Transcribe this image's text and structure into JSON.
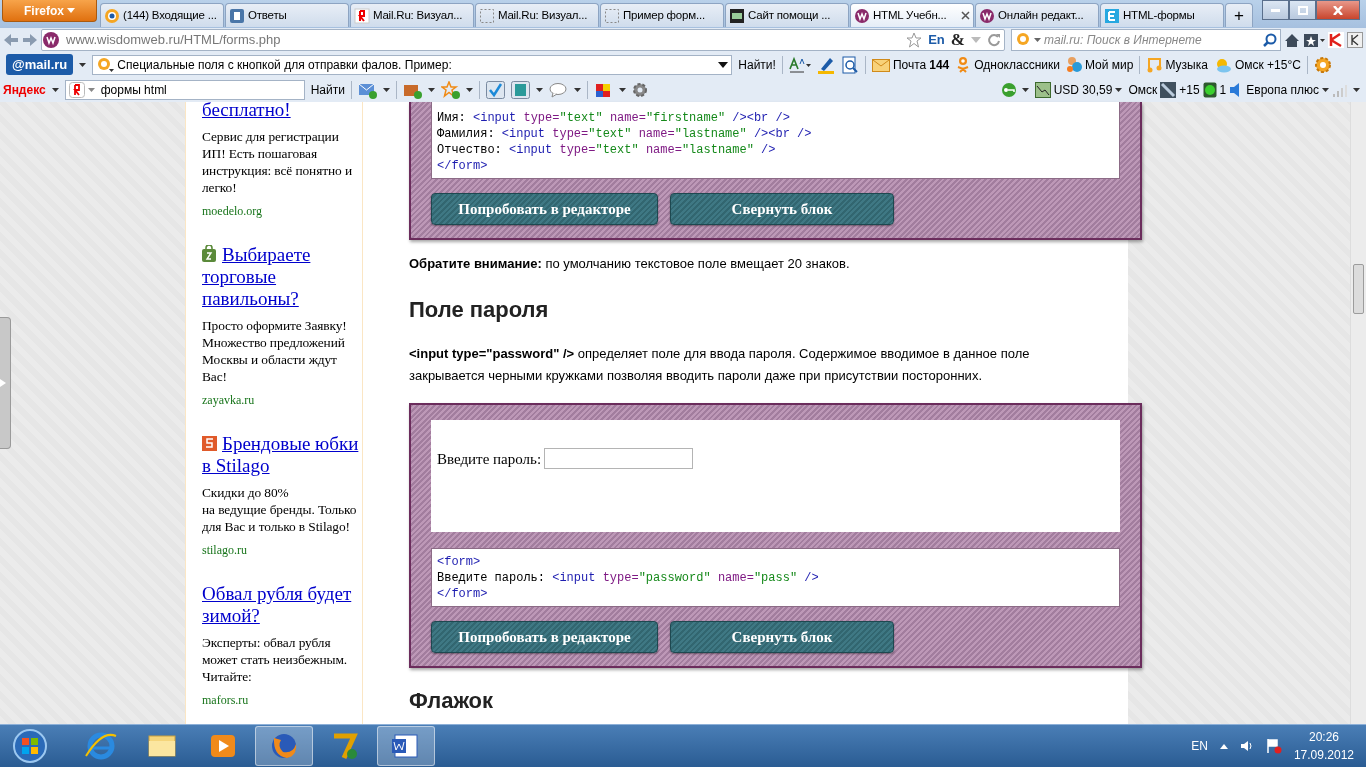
{
  "browser": {
    "menu_button": "Firefox",
    "tabs": [
      {
        "label": "(144) Входящие ...",
        "selected": false
      },
      {
        "label": "Ответы",
        "selected": false
      },
      {
        "label": "Mail.Ru: Визуал...",
        "selected": false
      },
      {
        "label": "Mail.Ru: Визуал...",
        "selected": false
      },
      {
        "label": "Пример форм...",
        "selected": false
      },
      {
        "label": "Сайт помощи ...",
        "selected": false
      },
      {
        "label": "HTML Учебн...",
        "selected": true
      },
      {
        "label": "Онлайн редакт...",
        "selected": false
      },
      {
        "label": "HTML-формы",
        "selected": false
      }
    ],
    "new_tab": "+",
    "address": "www.wisdomweb.ru/HTML/forms.php",
    "lang_indicator": "En",
    "ampersand": "&",
    "search": {
      "placeholder": "mail.ru: Поиск в Интернете"
    }
  },
  "mailru_bar": {
    "logo": "@mail.ru",
    "query": "Специальные поля с кнопкой для отправки фалов. Пример:",
    "find_button": "Найти!",
    "mail_label": "Почта",
    "mail_count": "144",
    "links": [
      "Одноклассники",
      "Мой мир",
      "Музыка"
    ],
    "weather": "Омск +15°C"
  },
  "yandex_bar": {
    "logo": "Яндекс",
    "query": "формы html",
    "find_button": "Найти",
    "currency": "USD 30,59",
    "city": "Омск",
    "temperature": "+15",
    "count": "1",
    "radio": "Европа плюс"
  },
  "ads": [
    {
      "title": "бесплатно!",
      "text": "Сервис для регистрации ИП! Есть пошаговая инструкция: всё понятно и легко!",
      "domain": "moedelo.org"
    },
    {
      "title": "Выбираете торговые павильоны?",
      "text": "Просто оформите Заявку! Множество предложений Москвы и области ждут Вас!",
      "domain": "zayavka.ru"
    },
    {
      "title": "Брендовые юбки в Stilago",
      "text": "Скидки до 80%\nна ведущие бренды. Только для Вас и только в Stilago!",
      "domain": "stilago.ru"
    },
    {
      "title": "Обвал рубля будет зимой?",
      "text": "Эксперты: обвал рубля может стать неизбежным. Читайте:",
      "domain": "mafors.ru"
    }
  ],
  "article": [
    {
      "kind": "example",
      "cut_top": true,
      "code": [
        [
          {
            "kind": "text",
            "text": "Имя: "
          },
          {
            "kind": "tag",
            "text": "<input "
          },
          {
            "kind": "attr",
            "text": "type="
          },
          {
            "kind": "value",
            "text": "\"text\" "
          },
          {
            "kind": "attr",
            "text": "name="
          },
          {
            "kind": "value",
            "text": "\"firstname\" "
          },
          {
            "kind": "tag",
            "text": "/><br />"
          }
        ],
        [
          {
            "kind": "text",
            "text": "Фамилия: "
          },
          {
            "kind": "tag",
            "text": "<input "
          },
          {
            "kind": "attr",
            "text": "type="
          },
          {
            "kind": "value",
            "text": "\"text\" "
          },
          {
            "kind": "attr",
            "text": "name="
          },
          {
            "kind": "value",
            "text": "\"lastname\" "
          },
          {
            "kind": "tag",
            "text": "/><br />"
          }
        ],
        [
          {
            "kind": "text",
            "text": "Отчество: "
          },
          {
            "kind": "tag",
            "text": "<input "
          },
          {
            "kind": "attr",
            "text": "type="
          },
          {
            "kind": "value",
            "text": "\"text\" "
          },
          {
            "kind": "attr",
            "text": "name="
          },
          {
            "kind": "value",
            "text": "\"lastname\" "
          },
          {
            "kind": "tag",
            "text": "/>"
          }
        ],
        [
          {
            "kind": "tag",
            "text": "</form>"
          }
        ]
      ],
      "buttons": [
        "Попробовать в редакторе",
        "Свернуть блок"
      ]
    },
    {
      "kind": "paragraph",
      "text": "**Обратите внимание:** по умолчанию текстовое поле вмещает 20 знаков."
    },
    {
      "kind": "heading",
      "text": "Поле пароля"
    },
    {
      "kind": "paragraph",
      "text": "**<input type=\"password\" />** определяет поле для ввода пароля. Содержимое вводимое в данное поле закрывается черными кружками позволяя вводить пароли даже при присутствии посторонних."
    },
    {
      "kind": "example",
      "cut_top": false,
      "demo_label": "Введите пароль:",
      "code": [
        [
          {
            "kind": "tag",
            "text": "<form>"
          }
        ],
        [
          {
            "kind": "text",
            "text": "Введите пароль: "
          },
          {
            "kind": "tag",
            "text": "<input "
          },
          {
            "kind": "attr",
            "text": "type="
          },
          {
            "kind": "value",
            "text": "\"password\" "
          },
          {
            "kind": "attr",
            "text": "name="
          },
          {
            "kind": "value",
            "text": "\"pass\" "
          },
          {
            "kind": "tag",
            "text": "/>"
          }
        ],
        [
          {
            "kind": "tag",
            "text": "</form>"
          }
        ]
      ],
      "buttons": [
        "Попробовать в редакторе",
        "Свернуть блок"
      ]
    },
    {
      "kind": "heading",
      "text": "Флажок"
    }
  ],
  "taskbar": {
    "language": "EN",
    "time": "20:26",
    "date": "17.09.2012"
  }
}
